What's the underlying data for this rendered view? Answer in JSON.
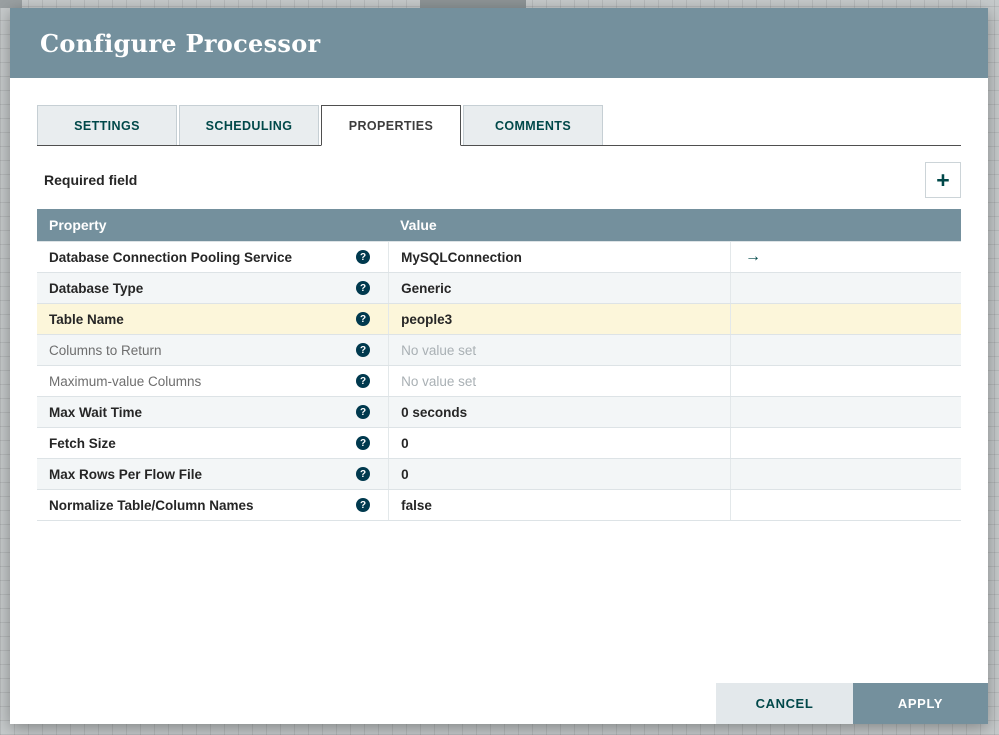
{
  "dialog": {
    "title": "Configure Processor",
    "tabs": [
      {
        "label": "SETTINGS"
      },
      {
        "label": "SCHEDULING"
      },
      {
        "label": "PROPERTIES"
      },
      {
        "label": "COMMENTS"
      }
    ],
    "active_tab": "PROPERTIES",
    "required_field_label": "Required field",
    "icons": {
      "add": "+",
      "help": "?",
      "go_to": "→"
    },
    "table": {
      "columns": [
        "Property",
        "Value"
      ],
      "rows": [
        {
          "name": "Database Connection Pooling Service",
          "value": "MySQLConnection",
          "required": true,
          "action": "→"
        },
        {
          "name": "Database Type",
          "value": "Generic",
          "required": true
        },
        {
          "name": "Table Name",
          "value": "people3",
          "required": true,
          "highlighted": true
        },
        {
          "name": "Columns to Return",
          "value": "No value set",
          "required": false
        },
        {
          "name": "Maximum-value Columns",
          "value": "No value set",
          "required": false
        },
        {
          "name": "Max Wait Time",
          "value": "0 seconds",
          "required": true
        },
        {
          "name": "Fetch Size",
          "value": "0",
          "required": true
        },
        {
          "name": "Max Rows Per Flow File",
          "value": "0",
          "required": true
        },
        {
          "name": "Normalize Table/Column Names",
          "value": "false",
          "required": true
        }
      ]
    },
    "buttons": {
      "cancel": "CANCEL",
      "apply": "APPLY"
    },
    "colors": {
      "header_bg": "#74909d",
      "accent_teal": "#004849",
      "highlight_row": "#fcf6da",
      "alt_row": "#f3f6f7",
      "cancel_bg": "#e3e8eb"
    }
  }
}
